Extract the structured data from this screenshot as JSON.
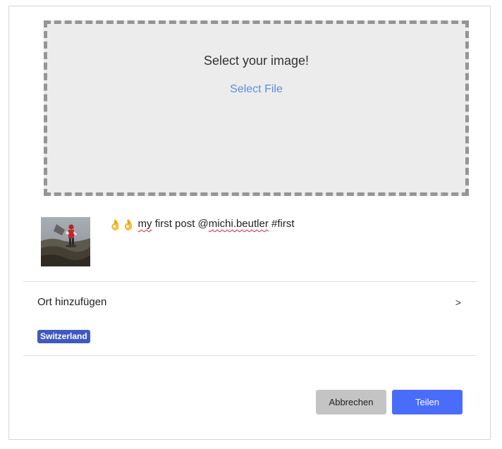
{
  "upload": {
    "title": "Select your image!",
    "select_label": "Select File"
  },
  "post": {
    "caption_emoji": "👌👌",
    "caption_word1": "my",
    "caption_middle": "first post @",
    "caption_mention": "michi.beutler",
    "caption_hashtag": "#first",
    "thumbnail_icon": "photo-thumbnail"
  },
  "location": {
    "label": "Ort hinzufügen",
    "arrow": ">",
    "tag": "Switzerland"
  },
  "actions": {
    "cancel_label": "Abbrechen",
    "share_label": "Teilen"
  },
  "colors": {
    "dropzone_bg": "#ececec",
    "dropzone_border": "#959595",
    "link": "#5b8fd9",
    "tag_bg": "#3f58c4",
    "cancel_bg": "#c4c4c4",
    "share_bg": "#4a6cfa"
  }
}
